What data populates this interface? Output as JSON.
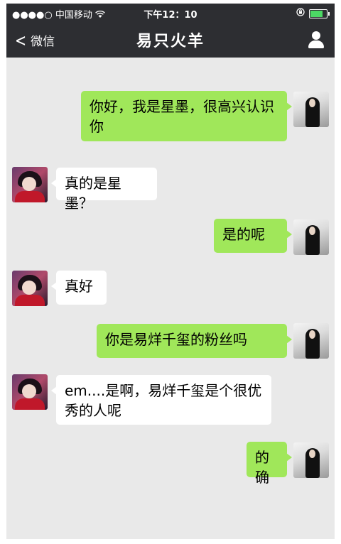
{
  "status_bar": {
    "signal": "●●●●○",
    "carrier": "中国移动",
    "wifi_icon": "wifi-icon",
    "time": "下午12：10",
    "lock_icon": "rotation-lock-icon",
    "battery_icon": "battery-icon"
  },
  "nav": {
    "back_label": "微信",
    "title": "易只火羊",
    "profile_icon": "person-icon"
  },
  "colors": {
    "bar": "#2d2e32",
    "chat_bg": "#e9e9e9",
    "mine_bubble": "#a0e75a",
    "theirs_bubble": "#ffffff"
  },
  "messages": [
    {
      "from": "me",
      "text": "你好，我是星墨，很高兴认识你"
    },
    {
      "from": "other",
      "text": "真的是星墨？"
    },
    {
      "from": "me",
      "text": "是的呢"
    },
    {
      "from": "other",
      "text": "真好"
    },
    {
      "from": "me",
      "text": "你是易烊千玺的粉丝吗"
    },
    {
      "from": "other",
      "text": "em....是啊，易烊千玺是个很优秀的人呢"
    },
    {
      "from": "me",
      "text": "的确"
    }
  ]
}
